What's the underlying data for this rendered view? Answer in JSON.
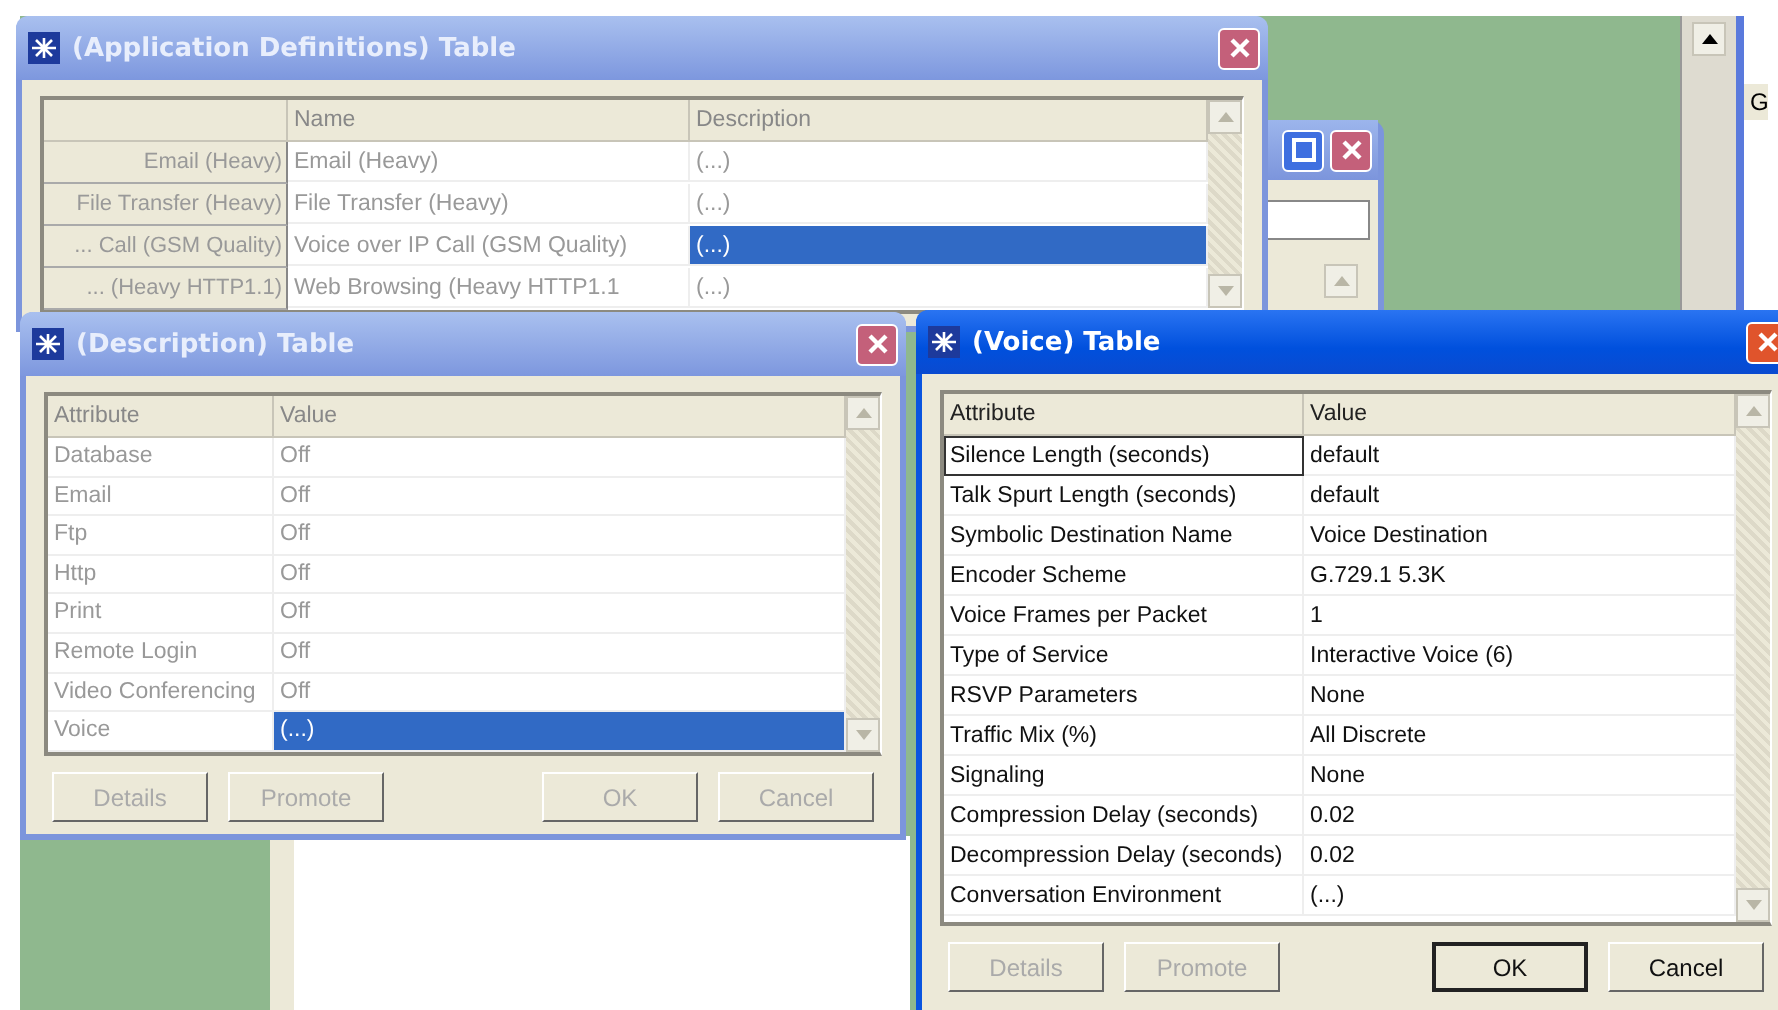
{
  "side_panel": {
    "text": "G"
  },
  "app_definitions": {
    "title": "(Application Definitions) Table",
    "active": false,
    "columns": [
      "Name",
      "Description"
    ],
    "rows": [
      {
        "header": "Email (Heavy)",
        "name": "Email (Heavy)",
        "description": "(...)",
        "selected": false
      },
      {
        "header": "File Transfer (Heavy)",
        "name": "File Transfer (Heavy)",
        "description": "(...)",
        "selected": false
      },
      {
        "header": "... Call (GSM Quality)",
        "name": "Voice over IP Call (GSM Quality)",
        "description": "(...)",
        "selected": true
      },
      {
        "header": "... (Heavy HTTP1.1)",
        "name": "Web Browsing (Heavy HTTP1.1",
        "description": "(...)",
        "selected": false
      }
    ]
  },
  "description": {
    "title": "(Description) Table",
    "active": false,
    "columns": [
      "Attribute",
      "Value"
    ],
    "rows": [
      {
        "attribute": "Database",
        "value": "Off",
        "selected": false,
        "focused": false
      },
      {
        "attribute": "Email",
        "value": "Off",
        "selected": false,
        "focused": false
      },
      {
        "attribute": "Ftp",
        "value": "Off",
        "selected": false,
        "focused": false
      },
      {
        "attribute": "Http",
        "value": "Off",
        "selected": false,
        "focused": false
      },
      {
        "attribute": "Print",
        "value": "Off",
        "selected": false,
        "focused": false
      },
      {
        "attribute": "Remote Login",
        "value": "Off",
        "selected": false,
        "focused": false
      },
      {
        "attribute": "Video Conferencing",
        "value": "Off",
        "selected": false,
        "focused": false
      },
      {
        "attribute": "Voice",
        "value": "(...)",
        "selected": true,
        "focused": false
      }
    ],
    "buttons": [
      {
        "label": "Details",
        "disabled": true,
        "default": false
      },
      {
        "label": "Promote",
        "disabled": true,
        "default": false
      },
      {
        "label": "OK",
        "disabled": true,
        "default": false
      },
      {
        "label": "Cancel",
        "disabled": true,
        "default": false
      }
    ]
  },
  "voice": {
    "title": "(Voice) Table",
    "active": true,
    "columns": [
      "Attribute",
      "Value"
    ],
    "rows": [
      {
        "attribute": "Silence Length (seconds)",
        "value": "default",
        "selected": false,
        "focused": true
      },
      {
        "attribute": "Talk Spurt Length (seconds)",
        "value": "default",
        "selected": false,
        "focused": false
      },
      {
        "attribute": "Symbolic Destination Name",
        "value": "Voice Destination",
        "selected": false,
        "focused": false
      },
      {
        "attribute": "Encoder Scheme",
        "value": "G.729.1 5.3K",
        "selected": false,
        "focused": false
      },
      {
        "attribute": "Voice Frames per Packet",
        "value": "1",
        "selected": false,
        "focused": false
      },
      {
        "attribute": "Type of Service",
        "value": "Interactive Voice (6)",
        "selected": false,
        "focused": false
      },
      {
        "attribute": "RSVP Parameters",
        "value": "None",
        "selected": false,
        "focused": false
      },
      {
        "attribute": "Traffic Mix (%)",
        "value": "All Discrete",
        "selected": false,
        "focused": false
      },
      {
        "attribute": "Signaling",
        "value": "None",
        "selected": false,
        "focused": false
      },
      {
        "attribute": "Compression Delay (seconds)",
        "value": "0.02",
        "selected": false,
        "focused": false
      },
      {
        "attribute": "Decompression Delay (seconds)",
        "value": "0.02",
        "selected": false,
        "focused": false
      },
      {
        "attribute": "Conversation Environment",
        "value": "(...)",
        "selected": false,
        "focused": false
      }
    ],
    "buttons": [
      {
        "label": "Details",
        "disabled": true,
        "default": false
      },
      {
        "label": "Promote",
        "disabled": true,
        "default": false
      },
      {
        "label": "OK",
        "disabled": false,
        "default": true
      },
      {
        "label": "Cancel",
        "disabled": false,
        "default": false
      }
    ]
  }
}
